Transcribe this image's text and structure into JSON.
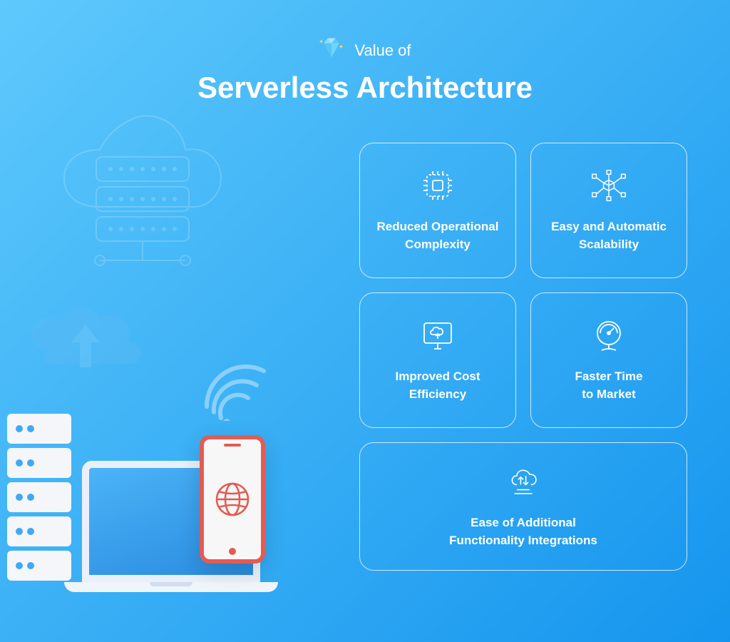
{
  "header": {
    "subtitle": "Value of",
    "title": "Serverless Architecture"
  },
  "cards": [
    {
      "label_line1": "Reduced Operational",
      "label_line2": "Complexity",
      "icon": "cpu-chip-icon"
    },
    {
      "label_line1": "Easy and Automatic",
      "label_line2": "Scalability",
      "icon": "network-cube-icon"
    },
    {
      "label_line1": "Improved Cost",
      "label_line2": "Efficiency",
      "icon": "monitor-upload-icon"
    },
    {
      "label_line1": "Faster Time",
      "label_line2": "to Market",
      "icon": "gauge-icon"
    },
    {
      "label_line1": "Ease of Additional",
      "label_line2": "Functionality Integrations",
      "icon": "cloud-sync-icon"
    }
  ]
}
